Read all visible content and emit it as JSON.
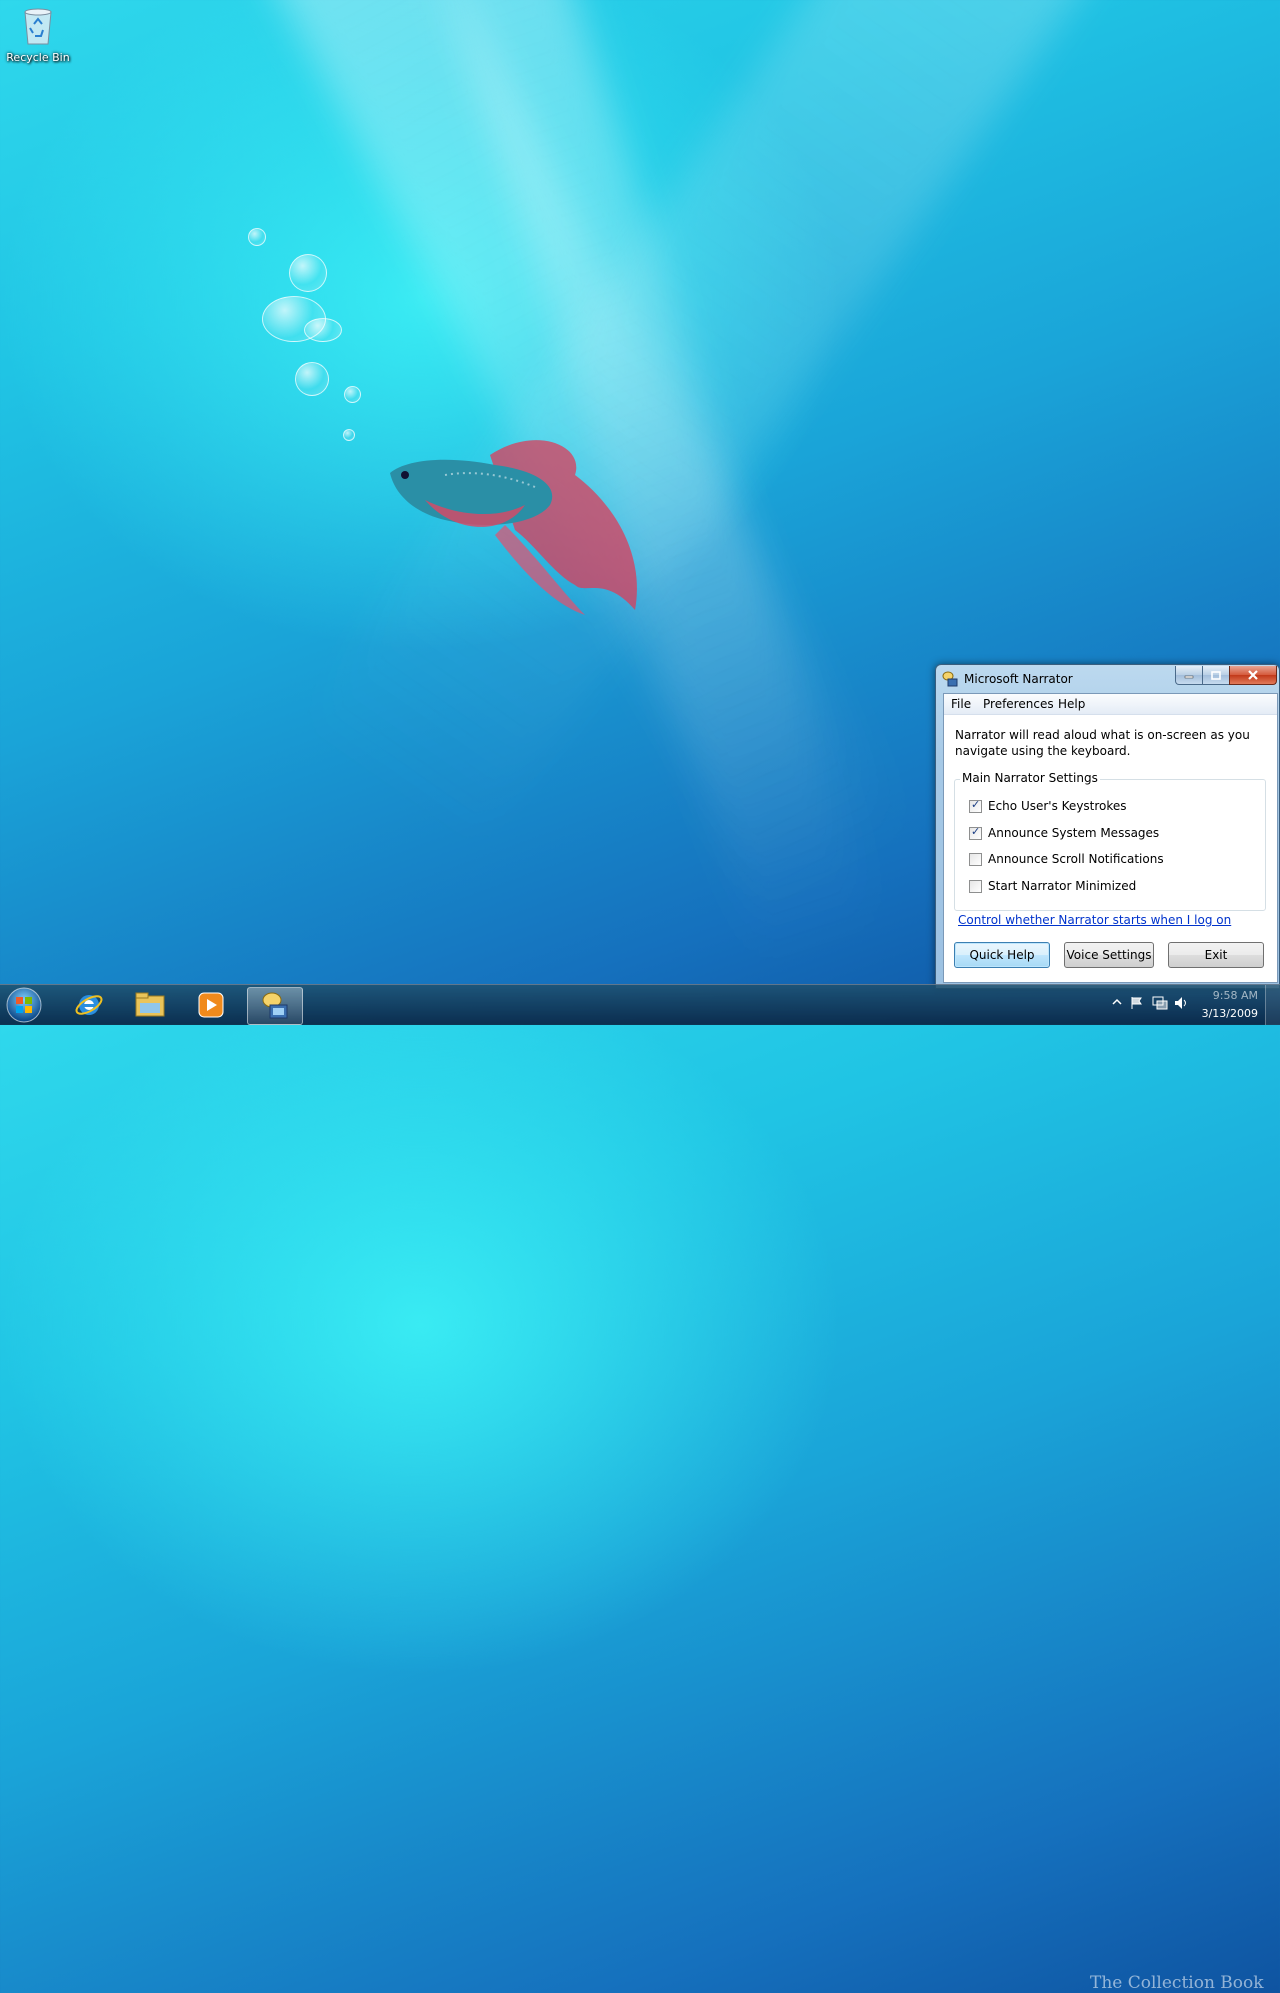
{
  "desktop": {
    "icons": [
      {
        "label": "Recycle Bin",
        "icon": "recycle-bin-icon"
      }
    ]
  },
  "window": {
    "title": "Microsoft Narrator",
    "controls": {
      "minimize": "minimize-icon",
      "maximize": "maximize-icon",
      "close": "close-icon"
    },
    "menu": [
      "File",
      "Preferences",
      "Help"
    ],
    "description": "Narrator will read aloud what is on-screen as you navigate using the keyboard.",
    "group_title": "Main Narrator Settings",
    "options": [
      {
        "label": "Echo User's Keystrokes",
        "checked": true
      },
      {
        "label": "Announce System Messages",
        "checked": true
      },
      {
        "label": "Announce Scroll Notifications",
        "checked": false
      },
      {
        "label": "Start Narrator Minimized",
        "checked": false
      }
    ],
    "link": "Control whether Narrator starts when I log on",
    "buttons": {
      "quick_help": "Quick Help",
      "voice_settings": "Voice Settings",
      "exit": "Exit"
    }
  },
  "taskbar": {
    "pinned": [
      "start-orb-icon",
      "internet-explorer-icon",
      "windows-explorer-icon",
      "media-player-icon",
      "narrator-icon"
    ],
    "tray": {
      "time": "9:58 AM",
      "date": "3/13/2009"
    },
    "watermark": "The Collection Book"
  }
}
